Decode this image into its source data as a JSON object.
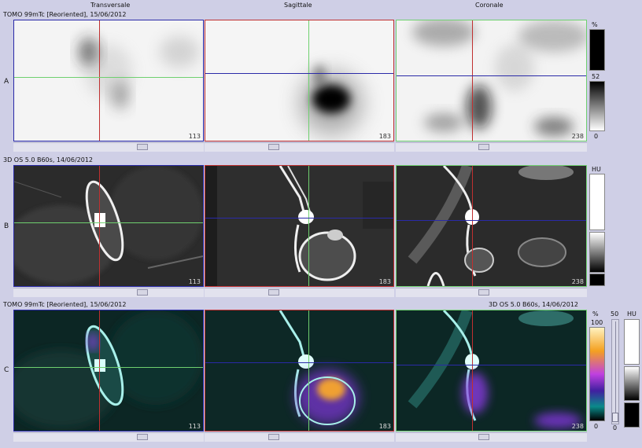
{
  "columns": {
    "transversal": "Transversale",
    "sagittal": "Sagittale",
    "coronal": "Coronale"
  },
  "rows": {
    "a": {
      "label": "A",
      "series_info": "TOMO 99mTc [Reoriented], 15/06/2012"
    },
    "b": {
      "label": "B",
      "series_info": "3D  OS  5.0  B60s, 14/06/2012"
    },
    "c": {
      "label": "C",
      "series_info_left": "TOMO 99mTc [Reoriented], 15/06/2012",
      "series_info_right": "3D  OS  5.0  B60s, 14/06/2012"
    }
  },
  "slices": {
    "transversal": "113",
    "sagittal": "183",
    "coronal": "238"
  },
  "colorbars": {
    "a": {
      "unit": "%",
      "max": "52",
      "min": "0"
    },
    "b": {
      "unit": "HU"
    },
    "c": {
      "unit_pct": "%",
      "max_pct": "100",
      "min_pct": "0",
      "slider_top": "50",
      "slider_bottom": "0",
      "unit_hu": "HU"
    }
  },
  "colors": {
    "transversal_border": "#2a2aa8",
    "sagittal_border": "#c03030",
    "coronal_border": "#6fd06f"
  }
}
